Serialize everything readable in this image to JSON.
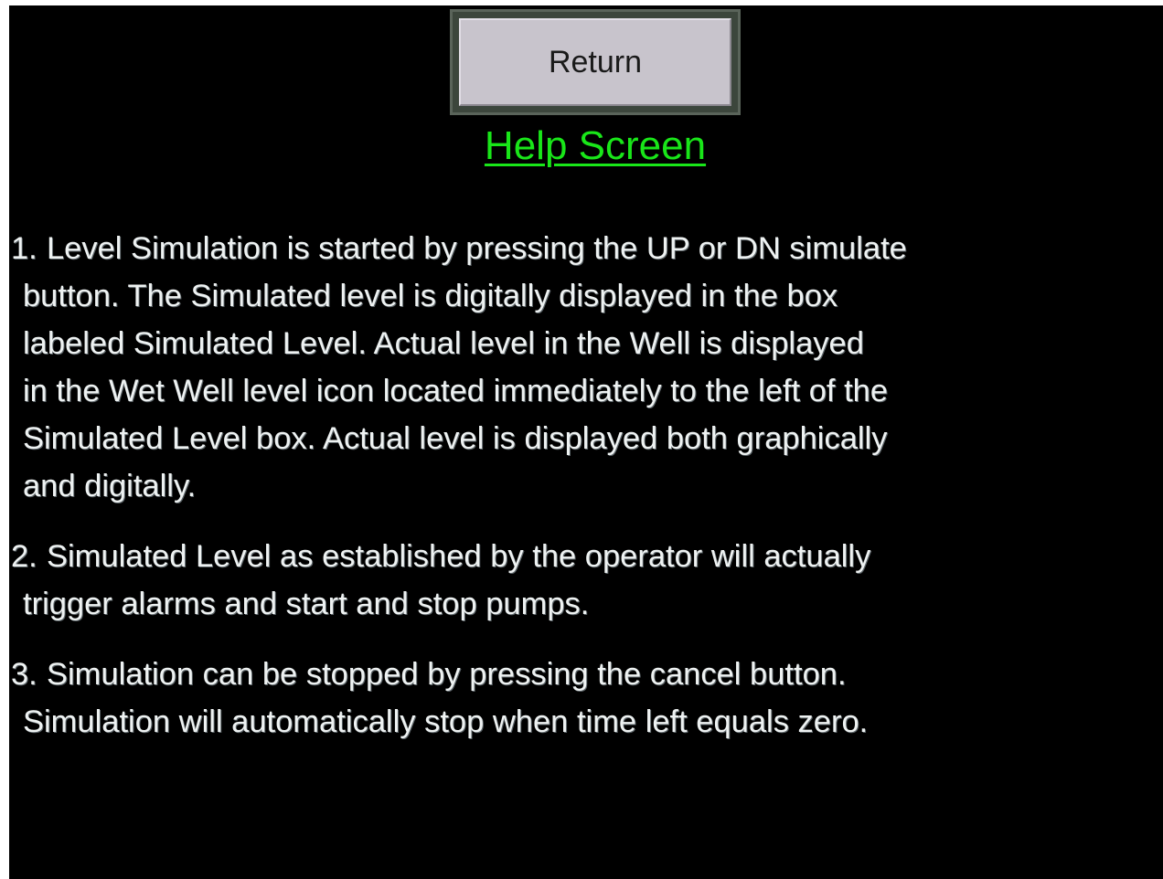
{
  "buttons": {
    "return_label": "Return"
  },
  "title": "Help Screen",
  "paragraphs": [
    {
      "number": "1.",
      "lines": [
        "Level Simulation is started by pressing the UP or DN simulate",
        "button. The Simulated level is digitally displayed in the box",
        "labeled Simulated Level. Actual level in the Well is displayed",
        "in the Wet Well level icon located immediately to the left of the",
        "Simulated Level box. Actual level is displayed both graphically",
        "and digitally."
      ]
    },
    {
      "number": "2.",
      "lines": [
        "Simulated Level as established by the operator will actually",
        "trigger alarms and start and stop pumps."
      ]
    },
    {
      "number": "3.",
      "lines": [
        "Simulation can be stopped by pressing the cancel button.",
        "Simulation will automatically stop when time left equals zero."
      ]
    }
  ],
  "colors": {
    "background": "#000000",
    "title": "#19e619",
    "text": "#eef2f2",
    "button_face": "#c8c4cc",
    "button_frame": "#3c463c"
  }
}
